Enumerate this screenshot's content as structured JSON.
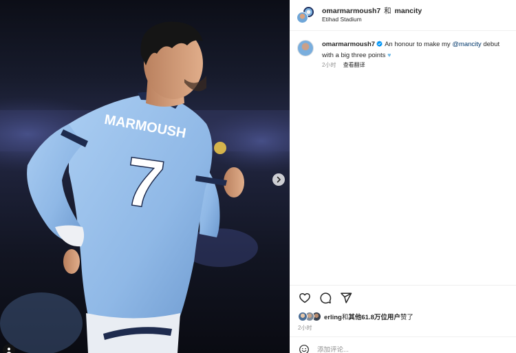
{
  "post": {
    "author": "omarmarmoush7",
    "join_word": "和",
    "collaborator": "mancity",
    "location": "Etihad Stadium",
    "caption": {
      "username": "omarmarmoush7",
      "text_before": "An honour to make my ",
      "mention": "@mancity",
      "text_after": " debut with a big three points ",
      "emoji": "♥"
    },
    "time_ago": "2小时",
    "see_translation": "查看翻译",
    "likes": {
      "liked_by": "erling",
      "connector": "和",
      "others": "其他61.8万位用户",
      "suffix": "赞了"
    },
    "likes_time": "2小时",
    "comment_placeholder": "添加评论...",
    "photo": {
      "jersey_name": "MARMOUSH",
      "jersey_number": "7",
      "jersey_color": "#9ec3ec",
      "background_color": "#1a1d30"
    }
  },
  "icons": {
    "like": "heart-icon",
    "comment": "comment-icon",
    "share": "share-icon",
    "next": "chevron-right-icon",
    "verified": "verified-badge-icon",
    "emoji": "emoji-icon",
    "tag": "user-tag-icon"
  }
}
